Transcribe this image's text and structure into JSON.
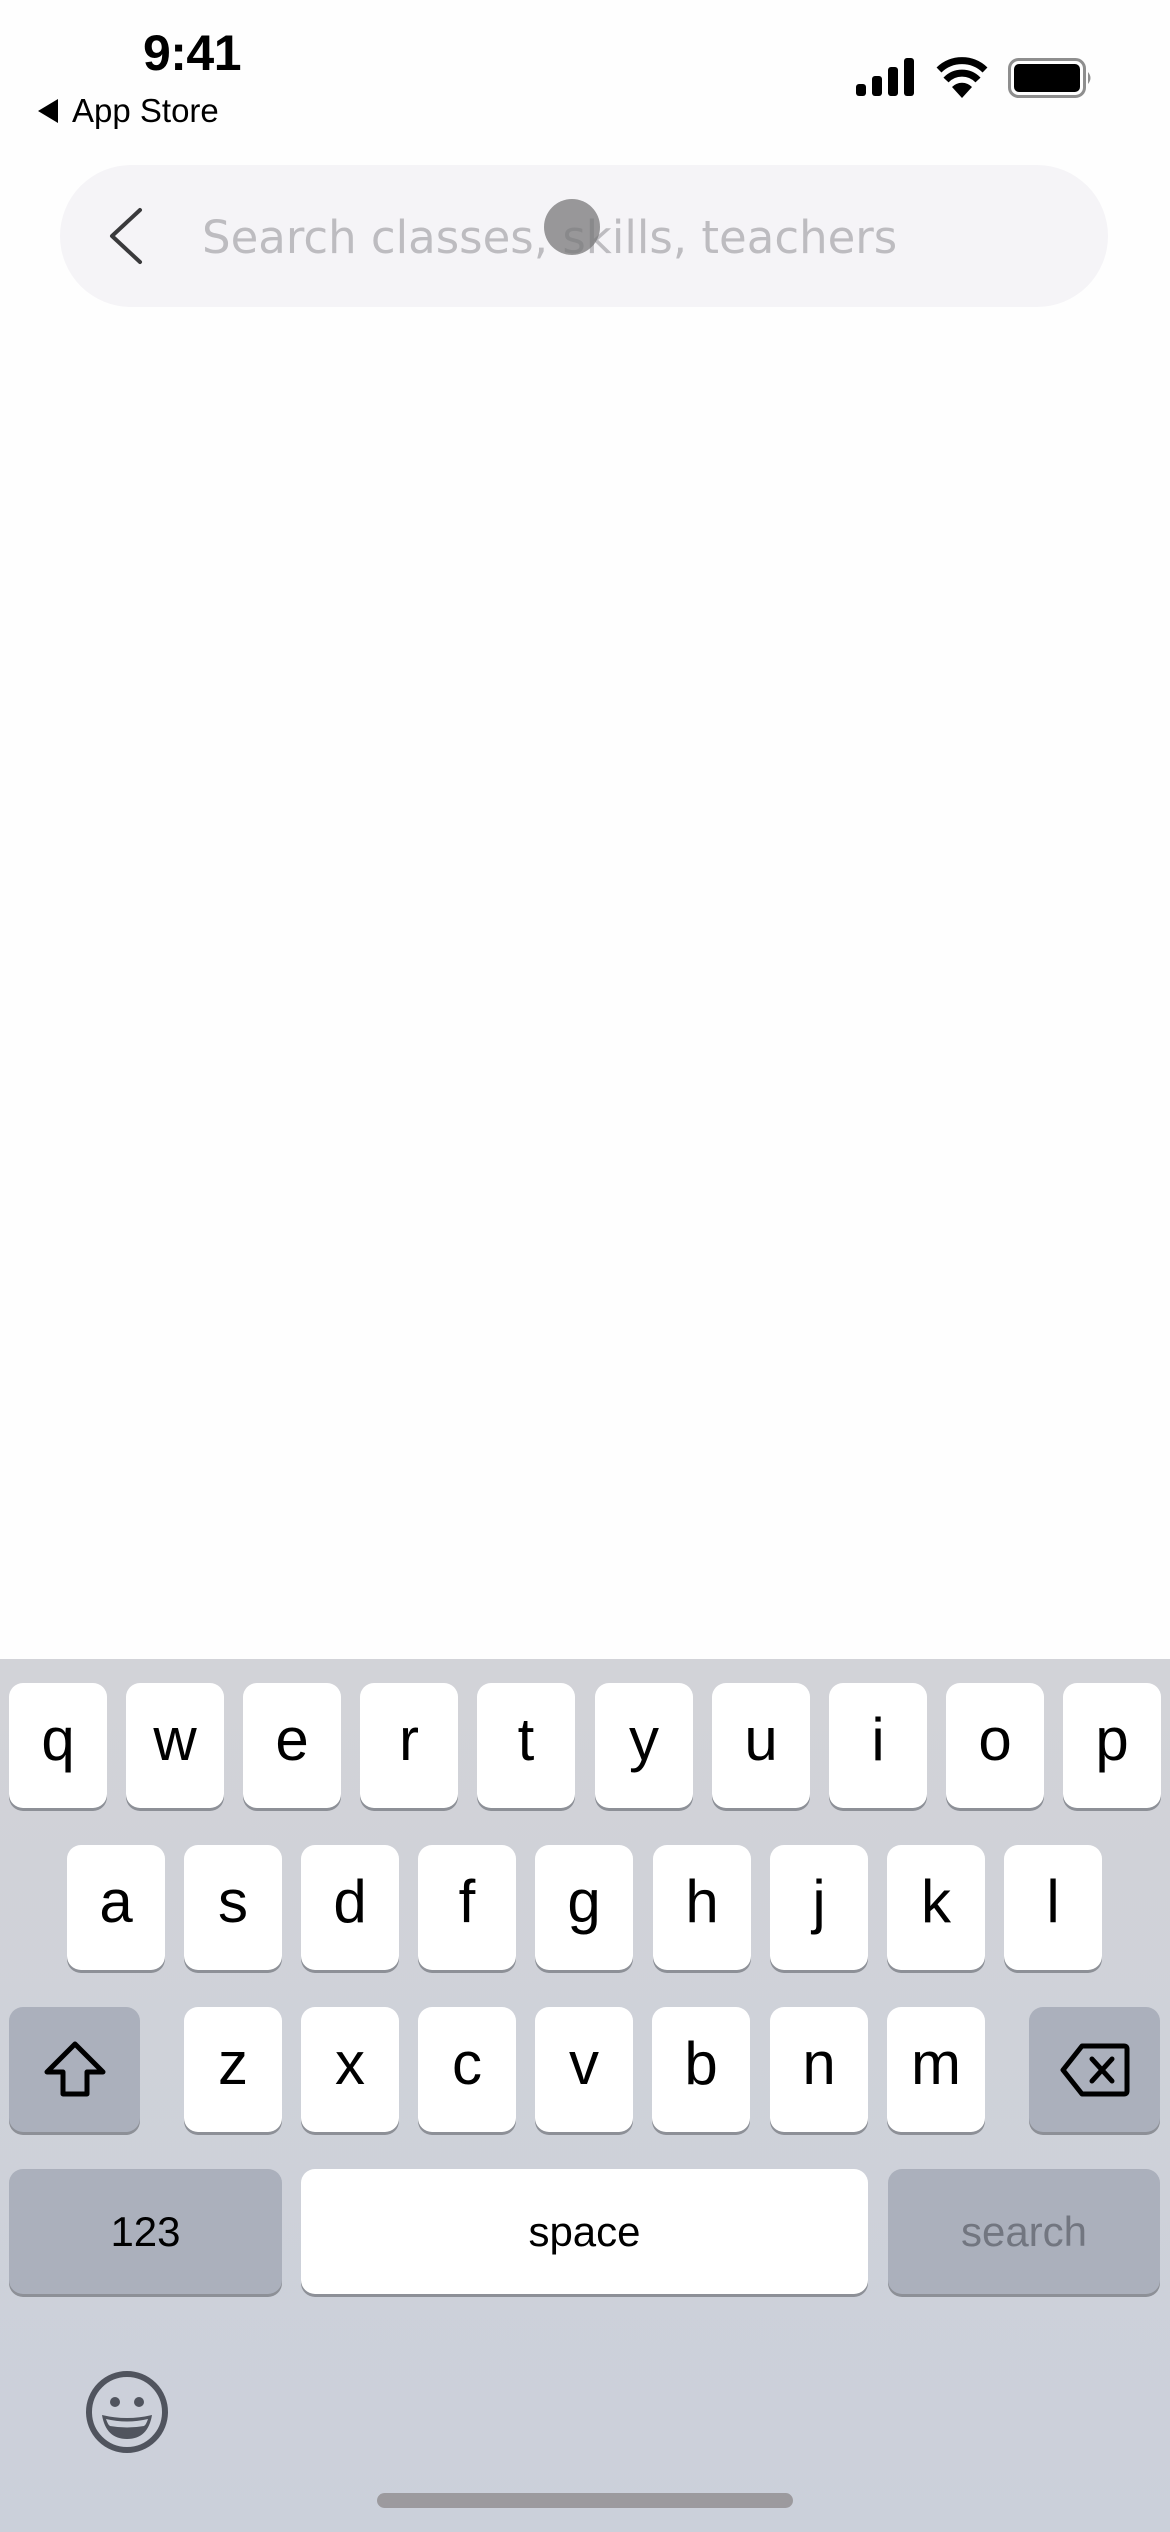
{
  "status_bar": {
    "time": "9:41",
    "back_app_label": "App Store",
    "icons": [
      "cellular-signal-icon",
      "wifi-icon",
      "battery-icon"
    ]
  },
  "search": {
    "placeholder": "Search classes, skills, teachers",
    "value": "",
    "back_icon": "chevron-left-icon"
  },
  "keyboard": {
    "row1": [
      "q",
      "w",
      "e",
      "r",
      "t",
      "y",
      "u",
      "i",
      "o",
      "p"
    ],
    "row2": [
      "a",
      "s",
      "d",
      "f",
      "g",
      "h",
      "j",
      "k",
      "l"
    ],
    "row3": [
      "z",
      "x",
      "c",
      "v",
      "b",
      "n",
      "m"
    ],
    "shift_icon": "shift-icon",
    "delete_icon": "delete-backspace-icon",
    "numbers_label": "123",
    "space_label": "space",
    "return_label": "search",
    "emoji_icon": "emoji-icon"
  },
  "colors": {
    "keyboard_bg": "#d2d3d8",
    "function_key": "#abb0bc",
    "search_field_bg": "#f5f4f7",
    "placeholder": "#bdbcc0"
  }
}
